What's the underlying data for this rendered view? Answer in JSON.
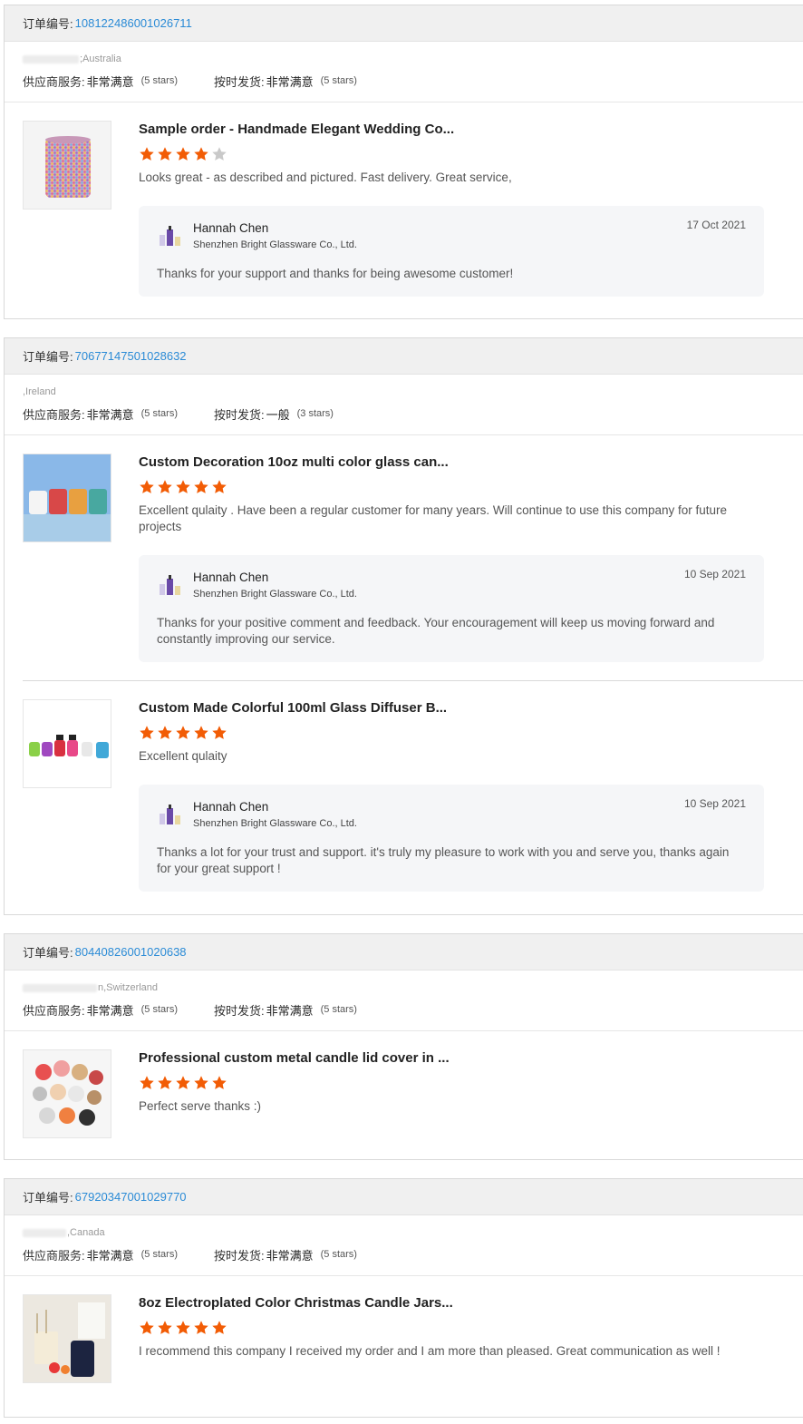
{
  "labels": {
    "order_no": "订单编号:",
    "supplier_service": "供应商服务:",
    "on_time": "按时发货:"
  },
  "colors": {
    "star_filled": "#f25c05",
    "star_empty": "#c9c9c9",
    "link": "#2b8bd6"
  },
  "orders": [
    {
      "order_number": "108122486001026711",
      "buyer_location": ";Australia",
      "supplier_service": {
        "value": "非常满意",
        "stars_text": "(5 stars)"
      },
      "on_time": {
        "value": "非常满意",
        "stars_text": "(5 stars)"
      },
      "products": [
        {
          "title": "Sample order - Handmade Elegant Wedding Co...",
          "rating": 4,
          "review": "Looks great - as described and pictured.  Fast delivery.  Great service,",
          "reply": {
            "name": "Hannah Chen",
            "company": "Shenzhen Bright Glassware Co., Ltd.",
            "date": "17 Oct 2021",
            "text": "Thanks for your support and thanks for being awesome customer!"
          }
        }
      ]
    },
    {
      "order_number": "70677147501028632",
      "buyer_location": ",Ireland",
      "supplier_service": {
        "value": "非常满意",
        "stars_text": "(5 stars)"
      },
      "on_time": {
        "value": "一般",
        "stars_text": "(3 stars)"
      },
      "products": [
        {
          "title": "Custom Decoration 10oz multi color glass can...",
          "rating": 5,
          "review": "Excellent qulaity . Have been a regular customer for many years. Will continue to use this company for future projects",
          "reply": {
            "name": "Hannah Chen",
            "company": "Shenzhen Bright Glassware Co., Ltd.",
            "date": "10 Sep 2021",
            "text": "Thanks for your positive comment and feedback. Your encouragement will keep us moving forward and constantly improving our service."
          }
        },
        {
          "title": "Custom Made Colorful 100ml Glass Diffuser B...",
          "rating": 5,
          "review": "Excellent qulaity",
          "reply": {
            "name": "Hannah Chen",
            "company": "Shenzhen Bright Glassware Co., Ltd.",
            "date": "10 Sep 2021",
            "text": "Thanks a lot for your trust and support.  it's truly my pleasure to work with you and serve you, thanks again for your great support !"
          }
        }
      ]
    },
    {
      "order_number": "80440826001020638",
      "buyer_location": "n,Switzerland",
      "supplier_service": {
        "value": "非常满意",
        "stars_text": "(5 stars)"
      },
      "on_time": {
        "value": "非常满意",
        "stars_text": "(5 stars)"
      },
      "products": [
        {
          "title": "Professional custom metal candle lid cover in ...",
          "rating": 5,
          "review": "Perfect serve thanks :)"
        }
      ]
    },
    {
      "order_number": "67920347001029770",
      "buyer_location": ",Canada",
      "supplier_service": {
        "value": "非常满意",
        "stars_text": "(5 stars)"
      },
      "on_time": {
        "value": "非常满意",
        "stars_text": "(5 stars)"
      },
      "products": [
        {
          "title": "8oz Electroplated Color Christmas Candle Jars...",
          "rating": 5,
          "review": "I recommend this company I received my order and I am more than pleased. Great communication as well !"
        }
      ]
    }
  ]
}
